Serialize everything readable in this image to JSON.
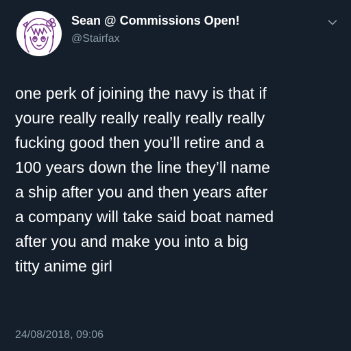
{
  "author": {
    "display_name": "Sean @ Commissions Open!",
    "handle": "@Stairfax",
    "avatar_icon": "anime-girl-sketch-avatar"
  },
  "menu": {
    "icon": "chevron-down-icon"
  },
  "tweet": {
    "lines": [
      "one perk of joining the navy is that if",
      "youre really really really really really",
      "fucking good then you’ll retire and a",
      "100 years down the line they’ll name",
      "a ship after you and then years after",
      "a company will take said boat named",
      "after you and make you into a big",
      "titty anime girl"
    ],
    "timestamp": "24/08/2018, 09:06"
  },
  "colors": {
    "background": "#151f2b",
    "primary_text": "#ffffff",
    "secondary_text": "#8899a6",
    "avatar_line": "#7d3a8c"
  }
}
